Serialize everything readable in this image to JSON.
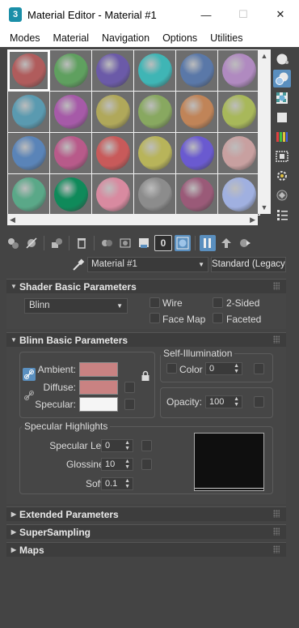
{
  "window": {
    "title": "Material Editor - Material #1",
    "app_icon_label": "3",
    "minimize": "—",
    "maximize": "☐",
    "close": "✕"
  },
  "menu": [
    "Modes",
    "Material",
    "Navigation",
    "Options",
    "Utilities"
  ],
  "slots": {
    "active_index": 0,
    "colors": [
      "#b05c5c",
      "#5fa05f",
      "#6b5aa8",
      "#3fb5b5",
      "#5a78a8",
      "#b08ac0",
      "#5a9ab0",
      "#a65aa8",
      "#b0a85a",
      "#88a860",
      "#c08458",
      "#a8b85a",
      "#5a84b8",
      "#b85a8a",
      "#c85a5a",
      "#b8b45a",
      "#6a5ad0",
      "#c8a0a0",
      "#5aa888",
      "#0f8a5a",
      "#d88aa0",
      "#8c8c8c",
      "#9a5a78",
      "#a0b0e0"
    ]
  },
  "side_toolbar": [
    {
      "icon": "sample-type-icon",
      "on": false
    },
    {
      "icon": "backlight-icon",
      "on": true
    },
    {
      "icon": "background-icon",
      "on": false
    },
    {
      "icon": "uv-tiling-icon",
      "on": false
    },
    {
      "icon": "video-color-check-icon",
      "on": false
    },
    {
      "icon": "make-preview-icon",
      "on": false
    },
    {
      "icon": "options-icon",
      "on": false
    },
    {
      "icon": "select-by-material-icon",
      "on": false
    },
    {
      "icon": "material-navigator-icon",
      "on": false
    }
  ],
  "toolbar": {
    "show_map_label": "0"
  },
  "material": {
    "name": "Material #1",
    "type": "Standard (Legacy)"
  },
  "shader_basic": {
    "title": "Shader Basic Parameters",
    "shader": "Blinn",
    "wire": "Wire",
    "two_sided": "2-Sided",
    "face_map": "Face Map",
    "faceted": "Faceted"
  },
  "blinn_basic": {
    "title": "Blinn Basic Parameters",
    "ambient_label": "Ambient:",
    "diffuse_label": "Diffuse:",
    "specular_label": "Specular:",
    "ambient_color": "#c98282",
    "diffuse_color": "#c98282",
    "specular_color": "#f5f5f5",
    "self_illum_title": "Self-Illumination",
    "self_illum_color_label": "Color",
    "self_illum_value": "0",
    "opacity_label": "Opacity:",
    "opacity_value": "100",
    "spec_highlights_title": "Specular Highlights",
    "spec_level_label": "Specular Level:",
    "spec_level_value": "0",
    "glossiness_label": "Glossiness:",
    "glossiness_value": "10",
    "soften_label": "Soften:",
    "soften_value": "0.1"
  },
  "collapsed_rollouts": [
    "Extended Parameters",
    "SuperSampling",
    "Maps"
  ]
}
